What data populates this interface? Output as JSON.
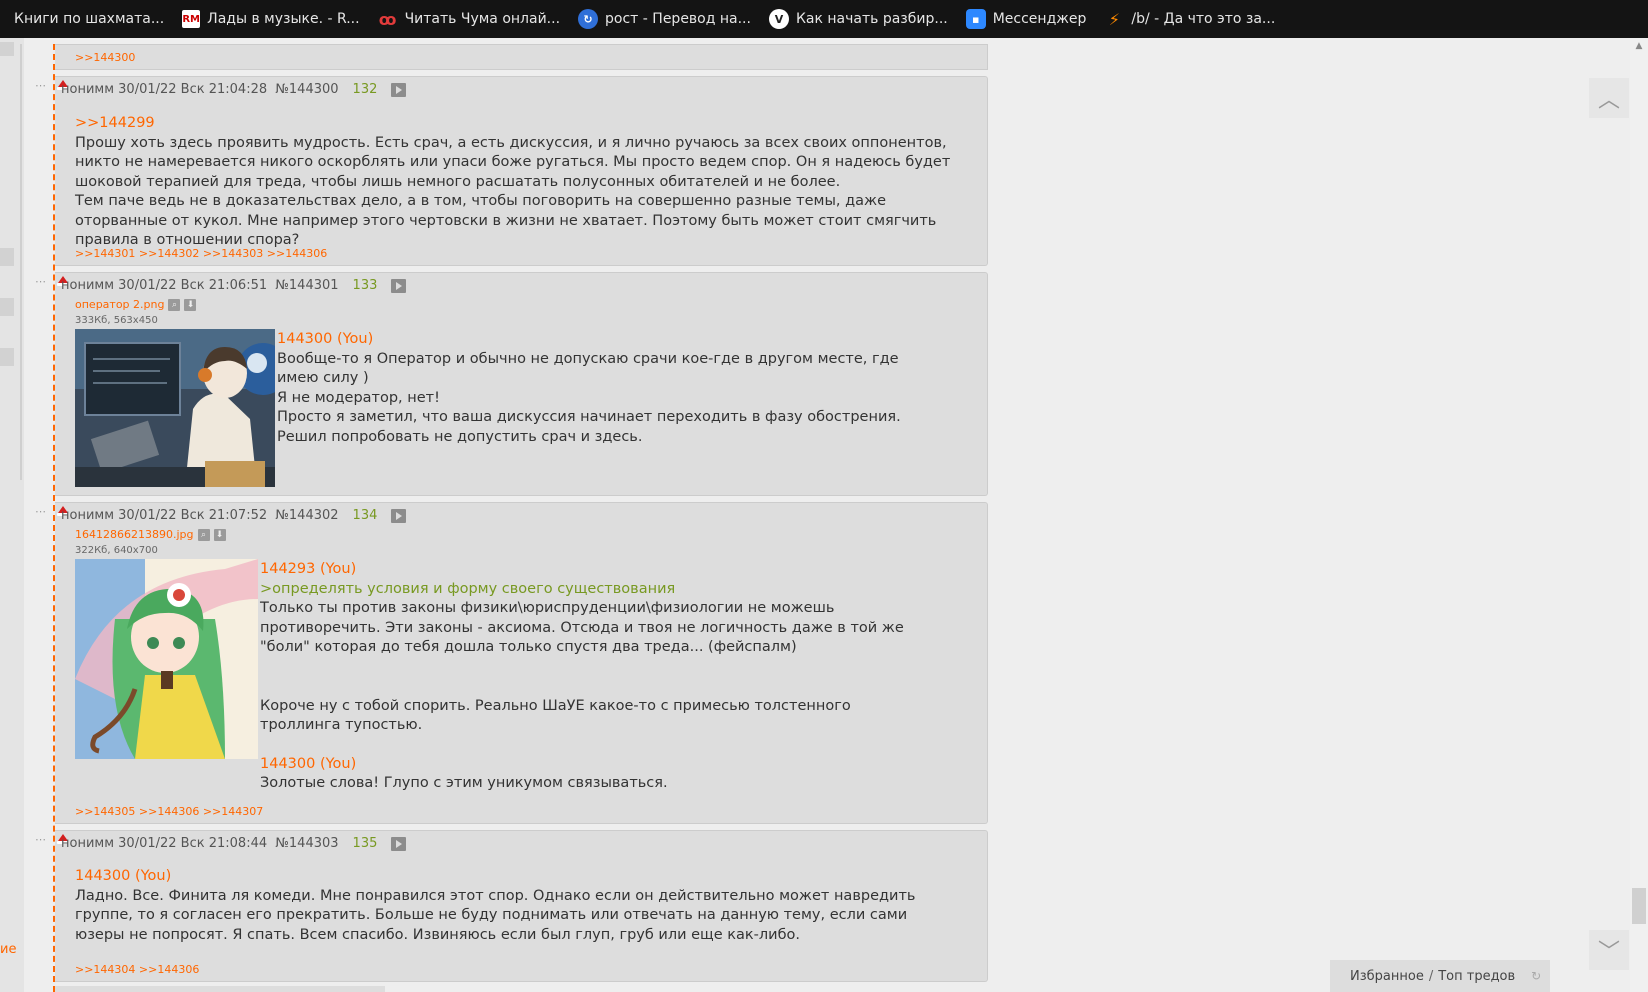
{
  "bookmarks": [
    {
      "label": "Книги по шахмата...",
      "icon": ""
    },
    {
      "label": "Лады в музыке. - R...",
      "icon": "RM"
    },
    {
      "label": "Читать Чума онлай...",
      "icon": "ꝏ"
    },
    {
      "label": "рост - Перевод на...",
      "icon": "↻"
    },
    {
      "label": "Как начать разбир...",
      "icon": "V"
    },
    {
      "label": "Мессенджер",
      "icon": "▪"
    },
    {
      "label": "/b/ - Да что это за...",
      "icon": "⚡"
    }
  ],
  "left_sidebar": {
    "partial_text": "ие"
  },
  "top_stub": {
    "refs": ">>144300"
  },
  "posts": [
    {
      "header": {
        "author": "нонимм",
        "date": "30/01/22 Вск 21:04:28",
        "num": "№144300",
        "counter": "132"
      },
      "lines": [
        {
          "type": "reply",
          "text": ">>144299"
        },
        {
          "type": "para",
          "text": "Прошу хоть здесь проявить мудрость. Есть срач, а есть дискуссия, и я лично ручаюсь за всех своих оппонентов, никто не намеревается никого оскорблять или упаси боже ругаться. Мы просто ведем спор. Он я надеюсь будет шоковой терапией для треда, чтобы лишь немного расшатать полусонных обитателей и не более."
        },
        {
          "type": "para",
          "text": "Тем паче ведь не в доказательствах дело, а в том, чтобы поговорить на совершенно разные темы, даже оторванные от кукол. Мне например этого чертовски в жизни не хватает. Поэтому быть может стоит смягчить правила в отношении спора?"
        }
      ],
      "refs": ">>144301 >>144302 >>144303 >>144306"
    },
    {
      "header": {
        "author": "нонимм",
        "date": "30/01/22 Вск 21:06:51",
        "num": "№144301",
        "counter": "133"
      },
      "file": {
        "name": "оператор 2.png",
        "size": "333Кб, 563x450"
      },
      "lines": [
        {
          "type": "reply",
          "text": "144300 (You)"
        },
        {
          "type": "para",
          "text": "Вообще-то я Оператор и обычно не допускаю срачи кое-где в другом месте, где имею силу )"
        },
        {
          "type": "para",
          "text": "Я не модератор, нет!"
        },
        {
          "type": "para",
          "text": "Просто я заметил, что ваша дискуссия начинает переходить в фазу обострения. Решил попробовать не допустить срач и здесь."
        }
      ],
      "refs": ""
    },
    {
      "header": {
        "author": "нонимм",
        "date": "30/01/22 Вск 21:07:52",
        "num": "№144302",
        "counter": "134"
      },
      "file": {
        "name": "16412866213890.jpg",
        "size": "322Кб, 640x700"
      },
      "lines": [
        {
          "type": "reply",
          "text": "144293 (You)"
        },
        {
          "type": "quote",
          "text": ">определять условия и форму своего существования"
        },
        {
          "type": "para",
          "text": "Только ты против законы физики\\юриспруденции\\физиологии не можешь противоречить. Эти законы - аксиома. Отсюда и твоя не логичность даже в той же \"боли\" которая до тебя дошла только спустя два треда... (фейспалм)"
        },
        {
          "type": "gap",
          "text": ""
        },
        {
          "type": "para",
          "text": "Короче ну с тобой спорить. Реально ШаУЕ какое-то с примесью толстенного троллинга тупостью."
        },
        {
          "type": "gap-small",
          "text": ""
        },
        {
          "type": "reply",
          "text": "144300 (You)"
        },
        {
          "type": "para",
          "text": "Золотые слова! Глупо с этим уникумом связываться."
        }
      ],
      "refs": ">>144305 >>144306 >>144307"
    },
    {
      "header": {
        "author": "нонимм",
        "date": "30/01/22 Вск 21:08:44",
        "num": "№144303",
        "counter": "135"
      },
      "lines": [
        {
          "type": "reply",
          "text": "144300 (You)"
        },
        {
          "type": "para",
          "text": "Ладно. Все. Финита ля комеди. Мне понравился этот спор. Однако если он действительно может навредить группе, то я согласен его прекратить. Больше не буду поднимать или отвечать на данную тему, если сами юзеры не попросят. Я спать. Всем спасибо. Извиняюсь если был глуп, груб или еще как-либо."
        }
      ],
      "refs": ">>144304 >>144306"
    }
  ],
  "favorites": {
    "left": "Избранное",
    "sep": "/",
    "right": "Топ тредов"
  },
  "colors": {
    "accent": "#ff6600",
    "quote": "#789922",
    "post_bg": "#dddddd",
    "page_bg": "#eeeeee",
    "bookmark_bar": "#141414"
  }
}
